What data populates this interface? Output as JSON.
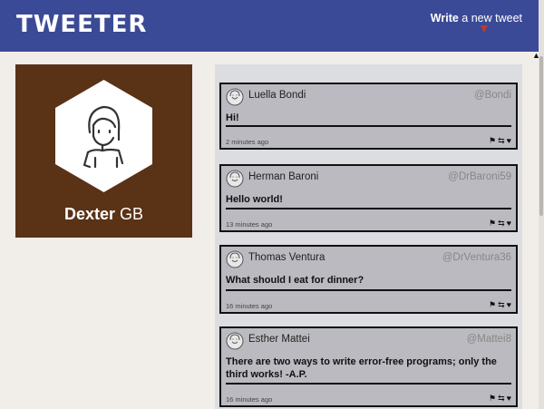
{
  "nav": {
    "logo": "TWEETER",
    "compose_bold": "Write",
    "compose_rest": " a new tweet"
  },
  "profile": {
    "first_name": "Dexter",
    "last_name": " GB",
    "avatar_icon": "woman-avatar-icon"
  },
  "colors": {
    "nav_bg": "#3b4a96",
    "page_bg": "#f1ede8",
    "profile_bg": "#5a3216",
    "tweet_bg": "#babac0",
    "accent_arrow": "#c0392b"
  },
  "tweets": [
    {
      "name": "Luella Bondi",
      "handle": "@Bondi",
      "text": "Hi!",
      "time": "2 minutes ago"
    },
    {
      "name": "Herman Baroni",
      "handle": "@DrBaroni59",
      "text": "Hello world!",
      "time": "13 minutes ago"
    },
    {
      "name": "Thomas Ventura",
      "handle": "@DrVentura36",
      "text": "What should I eat for dinner?",
      "time": "16 minutes ago"
    },
    {
      "name": "Esther Mattei",
      "handle": "@Mattei8",
      "text": "There are two ways to write error-free programs; only the third works! -A.P.",
      "time": "16 minutes ago"
    }
  ],
  "tweet_actions": {
    "flag_icon": "flag-icon",
    "retweet_icon": "retweet-icon",
    "like_icon": "heart-icon"
  }
}
